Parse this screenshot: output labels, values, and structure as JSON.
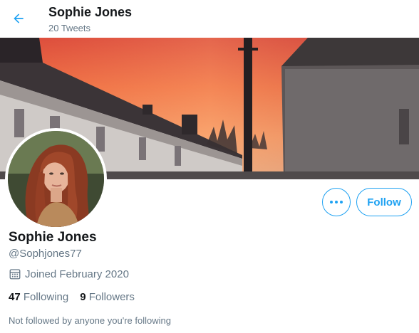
{
  "header": {
    "name": "Sophie Jones",
    "tweet_count": "20 Tweets"
  },
  "profile": {
    "name": "Sophie Jones",
    "handle": "@Sophjones77",
    "joined": "Joined February 2020",
    "following_count": "47",
    "following_label": "Following",
    "followers_count": "9",
    "followers_label": "Followers",
    "not_followed_text": "Not followed by anyone you're following"
  },
  "actions": {
    "follow_label": "Follow"
  },
  "icons": {
    "back": "arrow-left-icon",
    "more": "more-horizontal-icon",
    "calendar": "calendar-icon"
  },
  "colors": {
    "accent": "#1da1f2",
    "text": "#14171a",
    "secondary": "#657786"
  }
}
